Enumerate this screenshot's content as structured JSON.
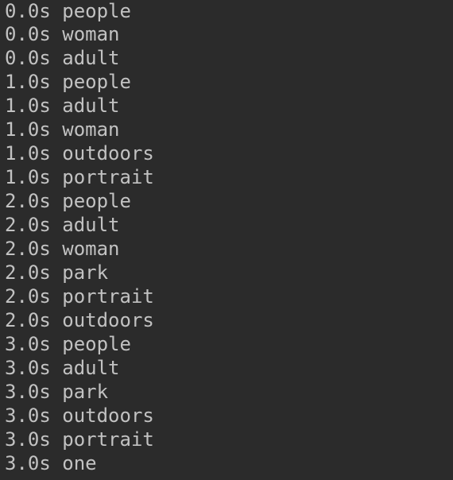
{
  "terminal": {
    "background_color": "#2b2b2b",
    "text_color": "#c2c2c2",
    "separator": " ",
    "lines": [
      {
        "timestamp": "0.0s",
        "label": "people"
      },
      {
        "timestamp": "0.0s",
        "label": "woman"
      },
      {
        "timestamp": "0.0s",
        "label": "adult"
      },
      {
        "timestamp": "1.0s",
        "label": "people"
      },
      {
        "timestamp": "1.0s",
        "label": "adult"
      },
      {
        "timestamp": "1.0s",
        "label": "woman"
      },
      {
        "timestamp": "1.0s",
        "label": "outdoors"
      },
      {
        "timestamp": "1.0s",
        "label": "portrait"
      },
      {
        "timestamp": "2.0s",
        "label": "people"
      },
      {
        "timestamp": "2.0s",
        "label": "adult"
      },
      {
        "timestamp": "2.0s",
        "label": "woman"
      },
      {
        "timestamp": "2.0s",
        "label": "park"
      },
      {
        "timestamp": "2.0s",
        "label": "portrait"
      },
      {
        "timestamp": "2.0s",
        "label": "outdoors"
      },
      {
        "timestamp": "3.0s",
        "label": "people"
      },
      {
        "timestamp": "3.0s",
        "label": "adult"
      },
      {
        "timestamp": "3.0s",
        "label": "park"
      },
      {
        "timestamp": "3.0s",
        "label": "outdoors"
      },
      {
        "timestamp": "3.0s",
        "label": "portrait"
      },
      {
        "timestamp": "3.0s",
        "label": "one"
      }
    ]
  }
}
